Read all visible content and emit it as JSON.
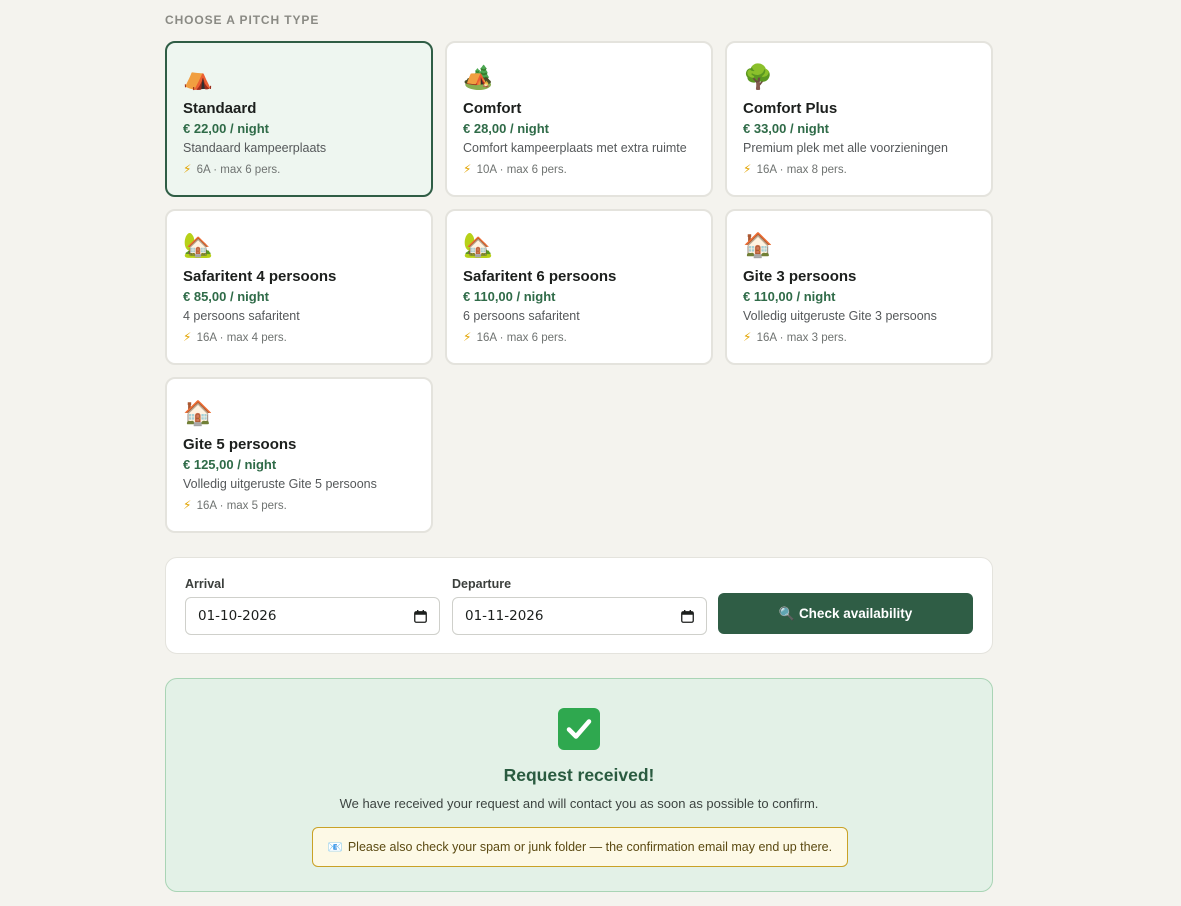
{
  "section_title": "CHOOSE A PITCH TYPE",
  "pitches": [
    {
      "emoji": "⛺",
      "name": "Standaard",
      "price": "€ 22,00 / night",
      "description": "Standaard kampeerplaats",
      "meta": "6A · max 6 pers.",
      "selected": true
    },
    {
      "emoji": "🏕️",
      "name": "Comfort",
      "price": "€ 28,00 / night",
      "description": "Comfort kampeerplaats met extra ruimte",
      "meta": "10A · max 6 pers.",
      "selected": false
    },
    {
      "emoji": "🌳",
      "name": "Comfort Plus",
      "price": "€ 33,00 / night",
      "description": "Premium plek met alle voorzieningen",
      "meta": "16A · max 8 pers.",
      "selected": false
    },
    {
      "emoji": "🏡",
      "name": "Safaritent 4 persoons",
      "price": "€ 85,00 / night",
      "description": "4 persoons safaritent",
      "meta": "16A · max 4 pers.",
      "selected": false
    },
    {
      "emoji": "🏡",
      "name": "Safaritent 6 persoons",
      "price": "€ 110,00 / night",
      "description": "6 persoons safaritent",
      "meta": "16A · max 6 pers.",
      "selected": false
    },
    {
      "emoji": "🏠",
      "name": "Gite 3 persoons",
      "price": "€ 110,00 / night",
      "description": "Volledig uitgeruste Gite 3 persoons",
      "meta": "16A · max 3 pers.",
      "selected": false
    },
    {
      "emoji": "🏠",
      "name": "Gite 5 persoons",
      "price": "€ 125,00 / night",
      "description": "Volledig uitgeruste Gite 5 persoons",
      "meta": "16A · max 5 pers.",
      "selected": false
    }
  ],
  "meta_icon": "⚡",
  "search": {
    "arrival_label": "Arrival",
    "arrival_value": "01-10-2026",
    "departure_label": "Departure",
    "departure_value": "01-11-2026",
    "button_icon": "🔍",
    "button_label": "Check availability"
  },
  "confirmation": {
    "icon": "check-mark-icon",
    "title": "Request received!",
    "text": "We have received your request and will contact you as soon as possible to confirm.",
    "notice_icon": "📧",
    "notice": "Please also check your spam or junk folder — the confirmation email may end up there."
  },
  "colors": {
    "accent": "#2f5d45",
    "price": "#2f6b48",
    "success_bg": "#e3f1e7",
    "notice_border": "#c9a227"
  }
}
